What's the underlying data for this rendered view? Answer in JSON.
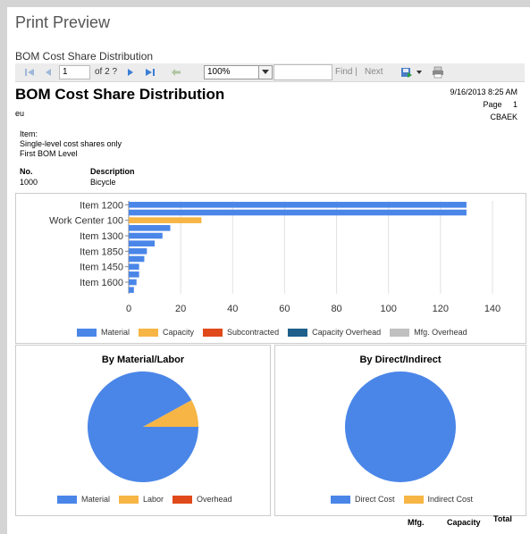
{
  "window": {
    "title": "Print Preview"
  },
  "document": {
    "title": "BOM Cost Share Distribution"
  },
  "toolbar": {
    "page_value": "1",
    "page_of": "of 2 ?",
    "zoom_value": "100%",
    "find_label": "Find",
    "separator": "|",
    "next_label": "Next",
    "icons": [
      "first-page-icon",
      "previous-page-icon",
      "next-page-icon",
      "last-page-icon",
      "back-icon",
      "dropdown-icon",
      "export-icon",
      "print-icon"
    ]
  },
  "report": {
    "title": "BOM Cost Share Distribution",
    "subtitle": "eu",
    "date": "9/16/2013 8:25 AM",
    "page_label": "Page",
    "page_number": "1",
    "user": "CBAEK",
    "filter_item": "Item:",
    "filter_line1": "Single-level cost shares only",
    "filter_line2": "First BOM Level",
    "col_no": "No.",
    "col_description": "Description",
    "no_value": "1000",
    "description_value": "Bicycle"
  },
  "colors": {
    "material": "#4a86e8",
    "capacity": "#f6b545",
    "subcontracted": "#e04a1a",
    "capacity_overhead": "#1f5f8b",
    "mfg_overhead": "#c0c0c0"
  },
  "chart_data": [
    {
      "type": "bar",
      "orientation": "horizontal",
      "categories": [
        "Item 1200",
        "",
        "Work Center 100",
        "",
        "Item 1300",
        "",
        "Item 1850",
        "",
        "Item 1450",
        "",
        "Item 1600",
        ""
      ],
      "series": [
        {
          "name": "Material",
          "values": [
            130,
            130,
            0,
            16,
            13,
            10,
            7,
            6,
            4,
            4,
            3,
            2
          ]
        },
        {
          "name": "Capacity",
          "values": [
            0,
            0,
            28,
            0,
            0,
            0,
            0,
            0,
            0,
            0,
            0,
            0
          ]
        },
        {
          "name": "Subcontracted",
          "values": [
            0,
            0,
            0,
            0,
            0,
            0,
            0,
            0,
            0,
            0,
            0,
            0
          ]
        },
        {
          "name": "Capacity Overhead",
          "values": [
            0,
            0,
            0,
            0,
            0,
            0,
            0,
            0,
            0,
            0,
            0,
            0
          ]
        },
        {
          "name": "Mfg. Overhead",
          "values": [
            0,
            0,
            0,
            0,
            0,
            0,
            0,
            0,
            0,
            0,
            0,
            0
          ]
        }
      ],
      "xlim": [
        0,
        140
      ],
      "xticks": [
        "0",
        "20",
        "40",
        "60",
        "80",
        "100",
        "120",
        "140"
      ],
      "grid": true,
      "legend": "bottom"
    },
    {
      "type": "pie",
      "title": "By Material/Labor",
      "labels": [
        "Material",
        "Labor",
        "Overhead"
      ],
      "values": [
        92,
        8,
        0
      ],
      "legend": "bottom"
    },
    {
      "type": "pie",
      "title": "By Direct/Indirect",
      "labels": [
        "Direct Cost",
        "Indirect Cost"
      ],
      "values": [
        100,
        0
      ],
      "legend": "bottom"
    }
  ],
  "bottom_headers": [
    "Mfg.",
    "Capacity",
    "Total"
  ]
}
